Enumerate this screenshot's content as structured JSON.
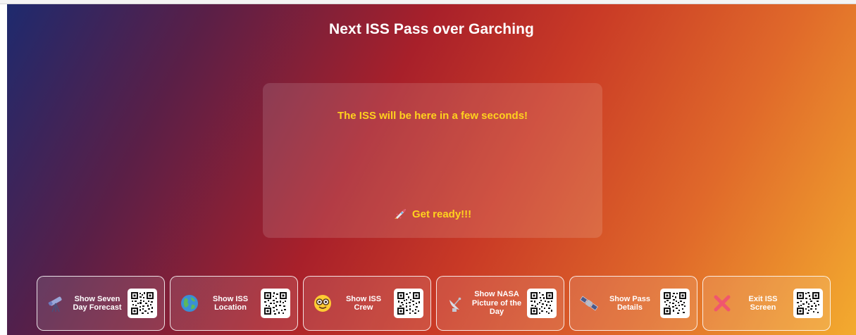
{
  "page": {
    "title": "Next ISS Pass over Garching"
  },
  "panel": {
    "message": "The ISS will be here in a few seconds!",
    "ready_text": "Get ready!!!",
    "ready_icon": "rocket-icon"
  },
  "buttons": [
    {
      "label": "Show Seven Day Forecast",
      "icon": "telescope-icon"
    },
    {
      "label": "Show ISS Location",
      "icon": "globe-icon"
    },
    {
      "label": "Show ISS Crew",
      "icon": "nerd-face-icon"
    },
    {
      "label": "Show NASA Picture of the Day",
      "icon": "satellite-dish-icon"
    },
    {
      "label": "Show Pass Details",
      "icon": "satellite-icon"
    },
    {
      "label": "Exit ISS Screen",
      "icon": "cross-mark-icon"
    }
  ],
  "colors": {
    "accent_text": "#ffd21e",
    "gradient_start": "#1e2a6e",
    "gradient_mid": "#a8202a",
    "gradient_end": "#f3ab2f"
  }
}
